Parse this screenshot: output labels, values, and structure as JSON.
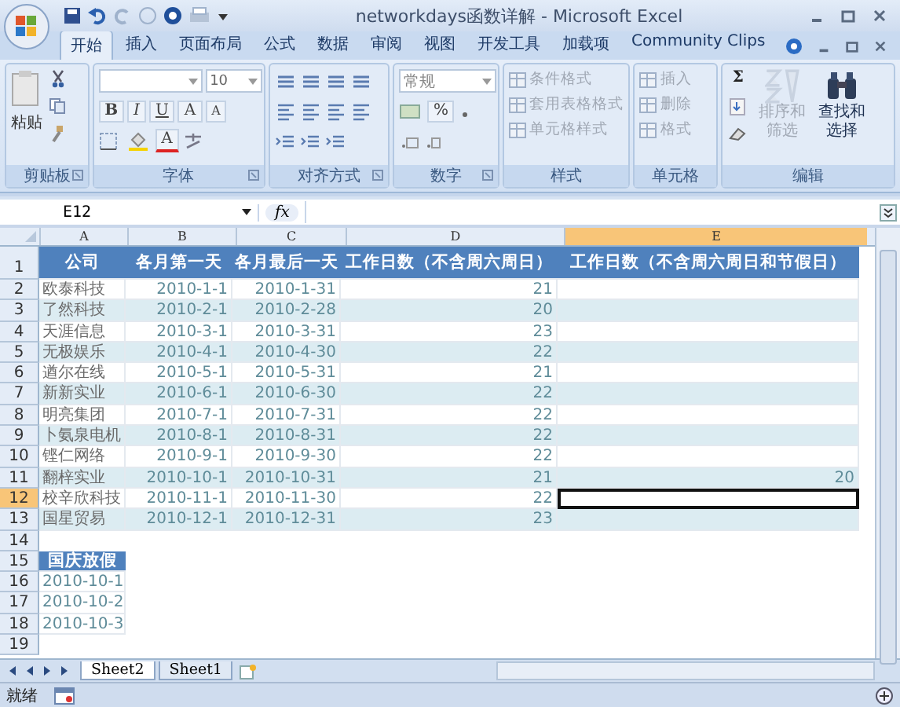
{
  "window": {
    "title": "networkdays函数详解 - Microsoft Excel"
  },
  "tabs": [
    {
      "label": "开始",
      "selected": true
    },
    {
      "label": "插入",
      "selected": false
    },
    {
      "label": "页面布局",
      "selected": false
    },
    {
      "label": "公式",
      "selected": false
    },
    {
      "label": "数据",
      "selected": false
    },
    {
      "label": "审阅",
      "selected": false
    },
    {
      "label": "视图",
      "selected": false
    },
    {
      "label": "开发工具",
      "selected": false
    },
    {
      "label": "加载项",
      "selected": false
    },
    {
      "label": "Community Clips",
      "selected": false
    }
  ],
  "ribbon": {
    "groups": [
      {
        "kind": "clipboard",
        "label": "剪贴板",
        "launcher": true,
        "paste": "粘贴"
      },
      {
        "kind": "font",
        "label": "字体",
        "launcher": true,
        "font_size": "10",
        "bold": "B",
        "italic": "I",
        "underline": "U",
        "grow": "A",
        "shrink": "A",
        "font_color": "A"
      },
      {
        "kind": "alignment",
        "label": "对齐方式",
        "launcher": true
      },
      {
        "kind": "number",
        "label": "数字",
        "launcher": true,
        "format": "常规",
        "percent": "%"
      },
      {
        "kind": "styles",
        "label": "样式",
        "launcher": false,
        "items": [
          {
            "label": "条件格式",
            "disabled": true
          },
          {
            "label": "套用表格格式",
            "disabled": true
          },
          {
            "label": "单元格样式",
            "disabled": true
          }
        ]
      },
      {
        "kind": "cells",
        "label": "单元格",
        "launcher": false,
        "items": [
          {
            "label": "插入",
            "disabled": true
          },
          {
            "label": "删除",
            "disabled": true
          },
          {
            "label": "格式",
            "disabled": true
          }
        ]
      },
      {
        "kind": "editing",
        "label": "编辑",
        "launcher": false,
        "sum": "Σ",
        "items": [
          {
            "label": "排序和筛选",
            "disabled": true
          },
          {
            "label": "查找和选择",
            "disabled": false
          }
        ]
      }
    ]
  },
  "formula_bar": {
    "name_box": "E12",
    "fx": "fx"
  },
  "sheet": {
    "columns": [
      {
        "label": "A",
        "selected": false
      },
      {
        "label": "B",
        "selected": false
      },
      {
        "label": "C",
        "selected": false
      },
      {
        "label": "D",
        "selected": false
      },
      {
        "label": "E",
        "selected": true
      }
    ],
    "rows": [
      {
        "number": "1",
        "selected": false,
        "kind": "header",
        "cells": [
          "公司",
          "各月第一天",
          "各月最后一天",
          "工作日数（不含周六周日）",
          "工作日数（不含周六周日和节假日）"
        ]
      },
      {
        "number": "2",
        "selected": false,
        "kind": "data",
        "cells": [
          "欧泰科技",
          "2010-1-1",
          "2010-1-31",
          "21",
          null
        ]
      },
      {
        "number": "3",
        "selected": false,
        "kind": "data",
        "cells": [
          "了然科技",
          "2010-2-1",
          "2010-2-28",
          "20",
          null
        ]
      },
      {
        "number": "4",
        "selected": false,
        "kind": "data",
        "cells": [
          "天涯信息",
          "2010-3-1",
          "2010-3-31",
          "23",
          null
        ]
      },
      {
        "number": "5",
        "selected": false,
        "kind": "data",
        "cells": [
          "无极娱乐",
          "2010-4-1",
          "2010-4-30",
          "22",
          null
        ]
      },
      {
        "number": "6",
        "selected": false,
        "kind": "data",
        "cells": [
          "遒尔在线",
          "2010-5-1",
          "2010-5-31",
          "21",
          null
        ]
      },
      {
        "number": "7",
        "selected": false,
        "kind": "data",
        "cells": [
          "新新实业",
          "2010-6-1",
          "2010-6-30",
          "22",
          null
        ]
      },
      {
        "number": "8",
        "selected": false,
        "kind": "data",
        "cells": [
          "明亮集团",
          "2010-7-1",
          "2010-7-31",
          "22",
          null
        ]
      },
      {
        "number": "9",
        "selected": false,
        "kind": "data",
        "cells": [
          "卜氨泉电机",
          "2010-8-1",
          "2010-8-31",
          "22",
          null
        ]
      },
      {
        "number": "10",
        "selected": false,
        "kind": "data",
        "cells": [
          "铿仁网络",
          "2010-9-1",
          "2010-9-30",
          "22",
          null
        ]
      },
      {
        "number": "11",
        "selected": false,
        "kind": "data",
        "cells": [
          "翻梓实业",
          "2010-10-1",
          "2010-10-31",
          "21",
          "20"
        ]
      },
      {
        "number": "12",
        "selected": true,
        "kind": "data",
        "cells": [
          "校辛欣科技",
          "2010-11-1",
          "2010-11-30",
          "22",
          null
        ]
      },
      {
        "number": "13",
        "selected": false,
        "kind": "data",
        "cells": [
          "国星贸易",
          "2010-12-1",
          "2010-12-31",
          "23",
          null
        ]
      },
      {
        "number": "14",
        "selected": false,
        "kind": "empty",
        "cells": []
      },
      {
        "number": "15",
        "selected": false,
        "kind": "header",
        "cells": [
          "国庆放假"
        ]
      },
      {
        "number": "16",
        "selected": false,
        "kind": "holiday",
        "cells": [
          "2010-10-1"
        ]
      },
      {
        "number": "17",
        "selected": false,
        "kind": "holiday",
        "cells": [
          "2010-10-2"
        ]
      },
      {
        "number": "18",
        "selected": false,
        "kind": "holiday",
        "cells": [
          "2010-10-3"
        ]
      },
      {
        "number": "19",
        "selected": false,
        "kind": "empty",
        "cells": []
      }
    ]
  },
  "sheet_tabs": [
    {
      "label": "Sheet2",
      "selected": true
    },
    {
      "label": "Sheet1",
      "selected": false
    }
  ],
  "status_bar": {
    "text": "就绪"
  }
}
